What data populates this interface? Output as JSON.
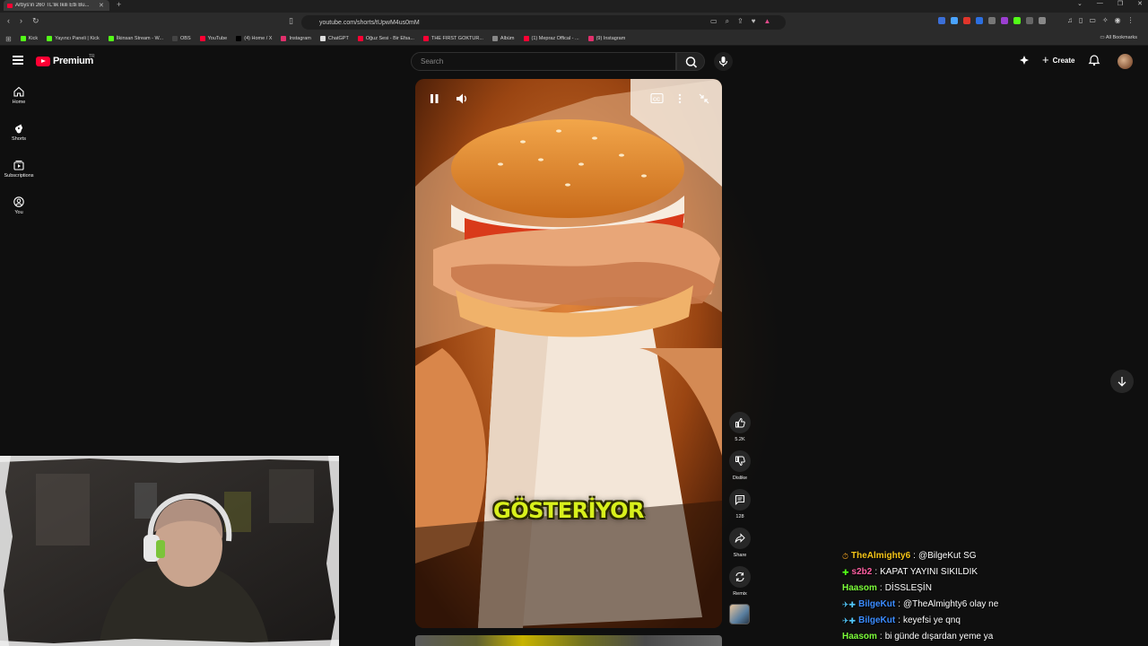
{
  "browser": {
    "tab_title": "Arbys'in 260 TL'lik İkili Etli Bu...",
    "url": "youtube.com/shorts/tUpwM4us0mM",
    "bookmarks": [
      {
        "label": "Kick",
        "color": "#53fc18"
      },
      {
        "label": "Yayıncı Paneli | Kick",
        "color": "#53fc18"
      },
      {
        "label": "İlkinsan Stream - W...",
        "color": "#53fc18"
      },
      {
        "label": "OBS",
        "color": "#444444"
      },
      {
        "label": "YouTube",
        "color": "#ff0033"
      },
      {
        "label": "(4) Home / X",
        "color": "#000000"
      },
      {
        "label": "Instagram",
        "color": "#e1306c"
      },
      {
        "label": "ChatGPT",
        "color": "#dddddd"
      },
      {
        "label": "Oğuz Sesi - Bir Efsa...",
        "color": "#ff0033"
      },
      {
        "label": "THE FIRST GOKTUR...",
        "color": "#ff0033"
      },
      {
        "label": "Albüm",
        "color": "#888888"
      },
      {
        "label": "(1) Mepraz Offical - ...",
        "color": "#ff0033"
      },
      {
        "label": "(9) Instagram",
        "color": "#e1306c"
      }
    ],
    "all_bookmarks": "All Bookmarks"
  },
  "youtube": {
    "logo_text": "Premium",
    "logo_region": "TR",
    "search_placeholder": "Search",
    "create_label": "Create",
    "nav": [
      {
        "label": "Home",
        "icon": "home-icon"
      },
      {
        "label": "Shorts",
        "icon": "shorts-icon"
      },
      {
        "label": "Subscriptions",
        "icon": "subscriptions-icon"
      },
      {
        "label": "You",
        "icon": "you-icon"
      }
    ],
    "short": {
      "caption_overlay": "GÖSTERİYOR",
      "likes": "5.2K",
      "dislike_label": "Dislike",
      "comments": "128",
      "share_label": "Share",
      "remix_label": "Remix"
    }
  },
  "chat": [
    {
      "badges": "⏱",
      "user": "TheAlmighty6",
      "user_color": "#f5c518",
      "message": "@BilgeKut SG"
    },
    {
      "badges": "✚",
      "user": "s2b2",
      "user_color": "#ff5fa2",
      "message": "KAPAT YAYINI SIKILDIK"
    },
    {
      "badges": "",
      "user": "Haasom",
      "user_color": "#7cfc3a",
      "message": "DİSSLEŞİN"
    },
    {
      "badges": "✈✚",
      "user": "BilgeKut",
      "user_color": "#3b8cff",
      "message": "@TheAlmighty6 olay ne"
    },
    {
      "badges": "✈✚",
      "user": "BilgeKut",
      "user_color": "#3b8cff",
      "message": "keyefsi ye qnq"
    },
    {
      "badges": "",
      "user": "Haasom",
      "user_color": "#7cfc3a",
      "message": "bi günde dışardan yeme ya"
    }
  ]
}
